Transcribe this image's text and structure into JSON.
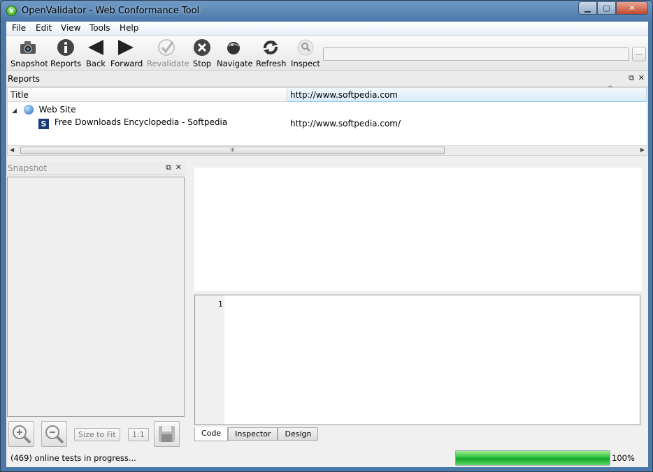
{
  "window": {
    "title": "OpenValidator - Web Conformance Tool",
    "min": "▁",
    "max": "▢",
    "close": "✕"
  },
  "menu": [
    "File",
    "Edit",
    "View",
    "Tools",
    "Help"
  ],
  "toolbar": {
    "snapshot": "Snapshot",
    "reports": "Reports",
    "back": "Back",
    "forward": "Forward",
    "revalidate": "Revalidate",
    "stop": "Stop",
    "navigate": "Navigate",
    "refresh": "Refresh",
    "inspect": "Inspect",
    "url_value": "",
    "more": "..."
  },
  "reports": {
    "title": "Reports",
    "columns": [
      "Title",
      "http://www.softpedia.com"
    ],
    "rows": [
      {
        "label": "Web Site",
        "url": ""
      },
      {
        "label": "Free Downloads Encyclopedia - Softpedia",
        "url": "http://www.softpedia.com/"
      }
    ],
    "scroll_grip": "III"
  },
  "snapshot": {
    "title": "Snapshot"
  },
  "editor": {
    "line_numbers": [
      "1"
    ]
  },
  "tabs": [
    "Code",
    "Inspector",
    "Design"
  ],
  "zoom": {
    "size_to_fit": "Size to Fit",
    "one_to_one": "1:1"
  },
  "status": {
    "text": "(469)  online tests in progress...",
    "progress": 100,
    "progress_label": "100%"
  },
  "colors": {
    "progress": "#2ec23e",
    "accent": "#4a78a8"
  }
}
